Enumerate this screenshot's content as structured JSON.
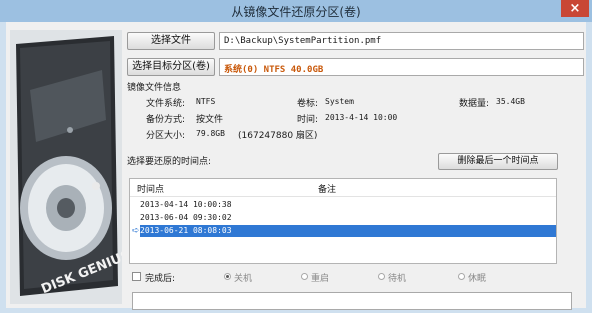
{
  "window": {
    "title": "从镜像文件还原分区(卷)",
    "close_label": "×"
  },
  "image_file": {
    "button_label": "选择文件",
    "path": "D:\\Backup\\SystemPartition.pmf"
  },
  "target": {
    "button_label": "选择目标分区(卷)",
    "value": "系统(0) NTFS 40.0GB"
  },
  "info": {
    "heading": "镜像文件信息",
    "fs_label": "文件系统:",
    "fs_value": "NTFS",
    "volume_label": "卷标:",
    "volume_value": "System",
    "data_label": "数据量:",
    "data_value": "35.4GB",
    "backup_mode_label": "备份方式:",
    "backup_mode_value": "按文件",
    "time_label": "时间:",
    "time_value": "2013-4-14 10:00",
    "size_label": "分区大小:",
    "size_value": "79.8GB",
    "sectors_value": "(167247880 扇区)"
  },
  "timepoints": {
    "heading": "选择要还原的时间点:",
    "delete_button": "删除最后一个时间点",
    "col_time": "时间点",
    "col_note": "备注",
    "rows": [
      "2013-04-14 10:00:38",
      "2013-06-04 09:30:02",
      "2013-06-21 08:08:03"
    ]
  },
  "after": {
    "checkbox_label": "完成后:",
    "options": [
      "关机",
      "重启",
      "待机",
      "休眠"
    ]
  },
  "brand": "DISK GENIUS"
}
